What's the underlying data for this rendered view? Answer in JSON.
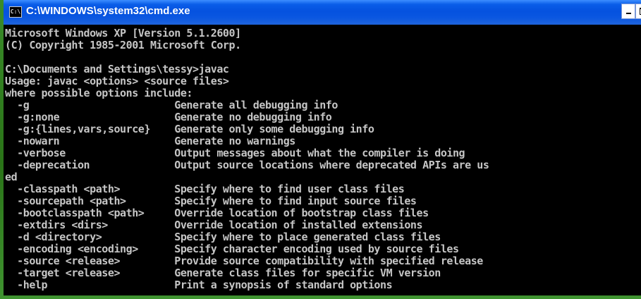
{
  "window": {
    "title": "C:\\WINDOWS\\system32\\cmd.exe",
    "icon_text": "C:\\"
  },
  "console": {
    "lines": [
      "Microsoft Windows XP [Version 5.1.2600]",
      "(C) Copyright 1985-2001 Microsoft Corp.",
      "",
      "C:\\Documents and Settings\\tessy>javac",
      "Usage: javac <options> <source files>",
      "where possible options include:",
      "  -g                        Generate all debugging info",
      "  -g:none                   Generate no debugging info",
      "  -g:{lines,vars,source}    Generate only some debugging info",
      "  -nowarn                   Generate no warnings",
      "  -verbose                  Output messages about what the compiler is doing",
      "  -deprecation              Output source locations where deprecated APIs are us",
      "ed",
      "  -classpath <path>         Specify where to find user class files",
      "  -sourcepath <path>        Specify where to find input source files",
      "  -bootclasspath <path>     Override location of bootstrap class files",
      "  -extdirs <dirs>           Override location of installed extensions",
      "  -d <directory>            Specify where to place generated class files",
      "  -encoding <encoding>      Specify character encoding used by source files",
      "  -source <release>         Provide source compatibility with specified release",
      "  -target <release>         Generate class files for specific VM version",
      "  -help                     Print a synopsis of standard options"
    ]
  },
  "colors": {
    "title_bar": "#0552df",
    "console_background": "#000000",
    "console_text": "#c6c6c6",
    "desktop": "#2f7d22"
  },
  "icons": {
    "window_icon": "cmd-icon",
    "minimize": "minimize-icon",
    "maximize": "maximize-icon"
  }
}
